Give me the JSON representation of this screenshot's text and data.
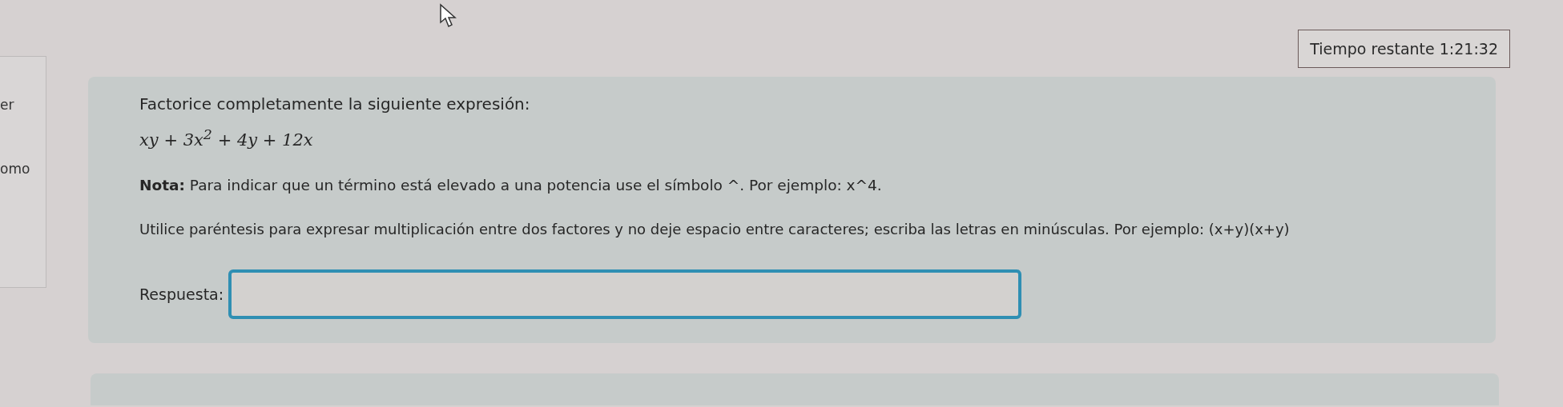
{
  "timer": {
    "label": "Tiempo restante",
    "value": "1:21:32"
  },
  "side_panel": {
    "texts": [
      "er",
      "omo"
    ]
  },
  "question": {
    "prompt": "Factorice completamente la siguiente expresión:",
    "expression": "xy + 3x$^{2}$ + 4y + 12x",
    "note": "**Nota:** Para indicar que un término está elevado a una potencia use el símbolo ^. Por ejemplo: x^4.",
    "instruction": "Utilice paréntesis para expresar multiplicación entre dos factores y no deje espacio entre caracteres; escriba las letras en minúsculas.  Por ejemplo: (x+y)(x+y)",
    "answer": {
      "label": "Respuesta:"
    }
  }
}
